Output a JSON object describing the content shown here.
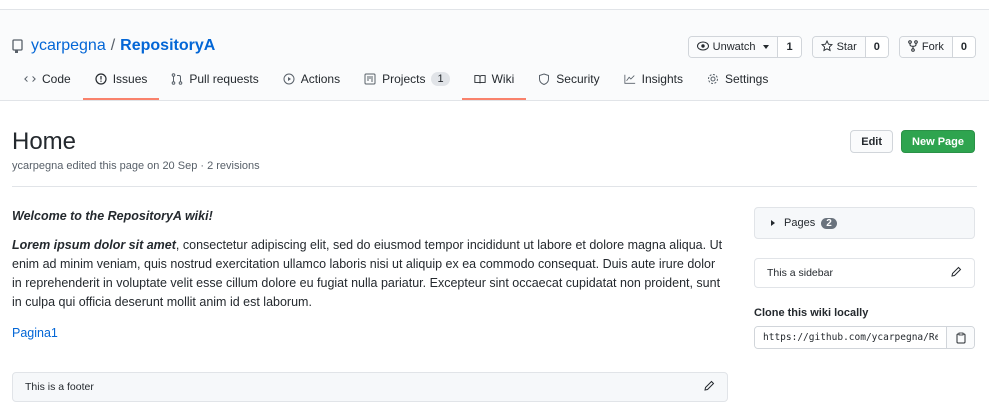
{
  "repo": {
    "owner": "ycarpegna",
    "separator": "/",
    "name": "RepositoryA"
  },
  "actions": {
    "watch_label": "Unwatch",
    "watch_count": "1",
    "star_label": "Star",
    "star_count": "0",
    "fork_label": "Fork",
    "fork_count": "0"
  },
  "tabs": [
    {
      "label": "Code",
      "icon": "code-icon"
    },
    {
      "label": "Issues",
      "icon": "issue-icon"
    },
    {
      "label": "Pull requests",
      "icon": "pull-request-icon"
    },
    {
      "label": "Actions",
      "icon": "play-icon"
    },
    {
      "label": "Projects",
      "icon": "project-icon",
      "count": "1"
    },
    {
      "label": "Wiki",
      "icon": "book-icon"
    },
    {
      "label": "Security",
      "icon": "shield-icon"
    },
    {
      "label": "Insights",
      "icon": "graph-icon"
    },
    {
      "label": "Settings",
      "icon": "gear-icon"
    }
  ],
  "page": {
    "title": "Home",
    "meta": "ycarpegna edited this page on 20 Sep · 2 revisions",
    "edit_label": "Edit",
    "new_page_label": "New Page"
  },
  "content": {
    "welcome": "Welcome to the RepositoryA wiki!",
    "lorem_bold": "Lorem ipsum dolor sit amet",
    "lorem_rest": ", consectetur adipiscing elit, sed do eiusmod tempor incididunt ut labore et dolore magna aliqua. Ut enim ad minim veniam, quis nostrud exercitation ullamco laboris nisi ut aliquip ex ea commodo consequat. Duis aute irure dolor in reprehenderit in voluptate velit esse cillum dolore eu fugiat nulla pariatur. Excepteur sint occaecat cupidatat non proident, sunt in culpa qui officia deserunt mollit anim id est laborum.",
    "link": "Pagina1",
    "footer": "This is a footer"
  },
  "sidebar": {
    "pages_label": "Pages",
    "pages_count": "2",
    "sidebar_text": "This a sidebar",
    "clone_label": "Clone this wiki locally",
    "clone_url": "https://github.com/ycarpegna/RepositoryA.wiki.git"
  },
  "colors": {
    "primary": "#2ea44f",
    "link": "#0366d6",
    "tab_underline": "#f9826c"
  }
}
